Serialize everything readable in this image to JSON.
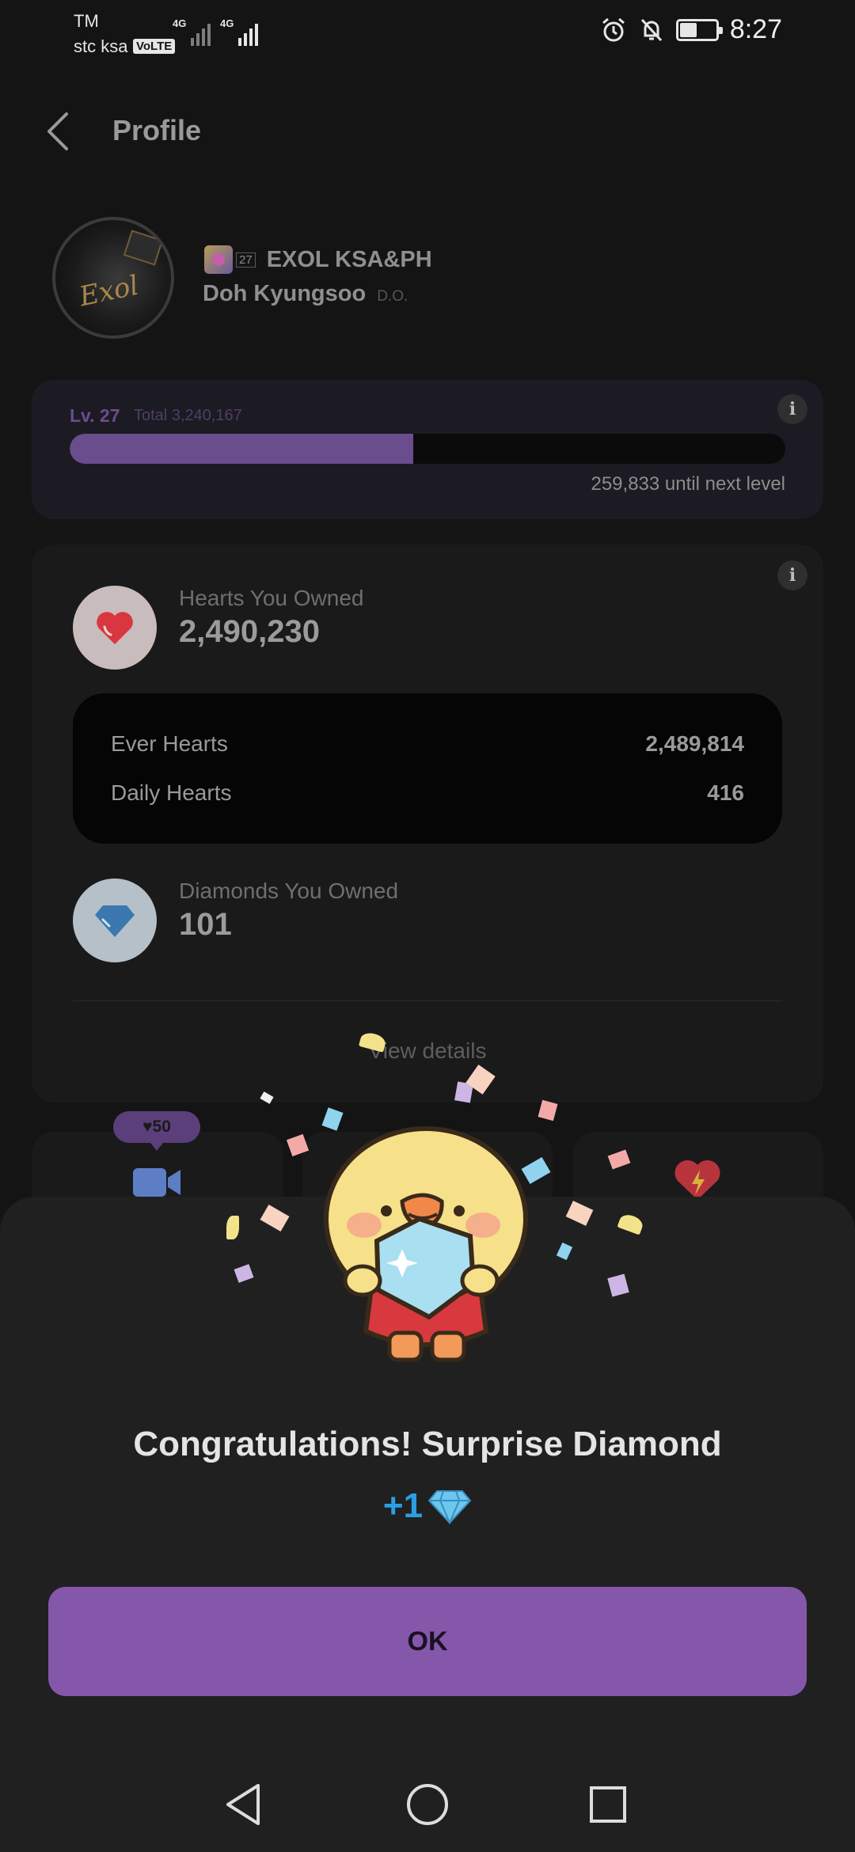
{
  "status_bar": {
    "carrier_top": "TM",
    "carrier_name": "stc ksa",
    "volte": "VoLTE",
    "network_1": "4G",
    "network_2": "4G",
    "time": "8:27",
    "icons": [
      "alarm-icon",
      "bell-off-icon",
      "battery-icon"
    ]
  },
  "header": {
    "title": "Profile",
    "back_icon": "chevron-left-icon"
  },
  "profile": {
    "badge_level": "27",
    "fanclub_name": "EXOL KSA&PH",
    "member_name": "Doh Kyungsoo",
    "member_tag": "D.O."
  },
  "level": {
    "label": "Lv. 27",
    "total": "Total 3,240,167",
    "progress": 0.48,
    "next_level_text": "259,833 until next level",
    "info_symbol": "i"
  },
  "owned": {
    "hearts_label": "Hearts You Owned",
    "hearts_value": "2,490,230",
    "ever_hearts_label": "Ever Hearts",
    "ever_hearts_value": "2,489,814",
    "daily_hearts_label": "Daily Hearts",
    "daily_hearts_value": "416",
    "diamonds_label": "Diamonds You Owned",
    "diamonds_value": "101",
    "view_details": "View details",
    "info_symbol": "i"
  },
  "mini_cards": {
    "price_pill": "♥50",
    "icons": [
      "video-camera-icon",
      "heart-bolt-icon"
    ]
  },
  "reward_sheet": {
    "title": "Congratulations! Surprise Diamond",
    "amount": "+1",
    "ok_label": "OK"
  },
  "colors": {
    "accent_purple": "#8557aa",
    "level_purple": "#6a4d8c",
    "diamond_blue": "#2b9fe4",
    "heart_red": "#d9373f",
    "background": "#141414",
    "sheet": "#202020"
  },
  "nav_bar": {
    "icons": [
      "back-triangle-icon",
      "home-circle-icon",
      "recents-square-icon"
    ]
  }
}
